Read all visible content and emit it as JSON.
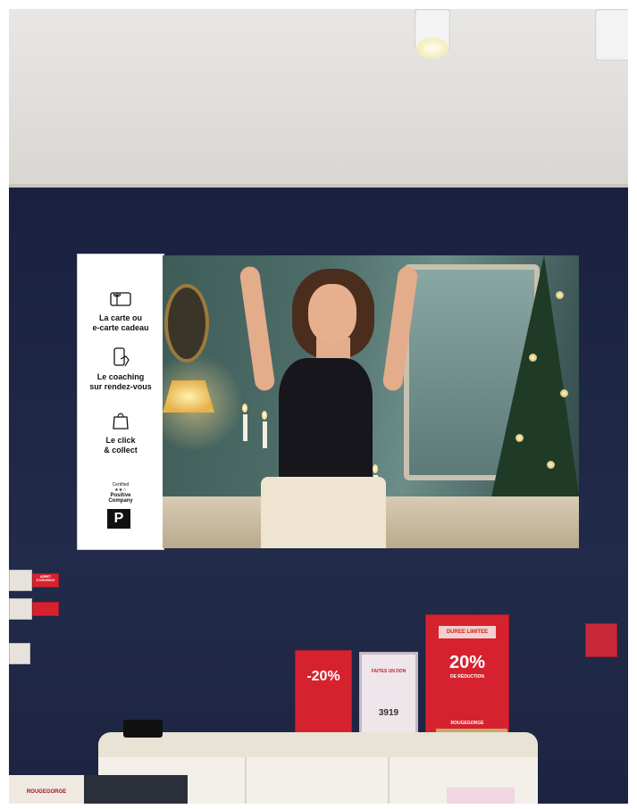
{
  "panel": {
    "services": [
      {
        "icon": "gift-card-icon",
        "label": "La carte ou\ne-carte cadeau"
      },
      {
        "icon": "phone-hand-icon",
        "label": "Le coaching\nsur rendez-vous"
      },
      {
        "icon": "shopping-bag-icon",
        "label": "Le click\n& collect"
      }
    ],
    "certified_line1": "Certified",
    "certified_line2": "Positive",
    "certified_line3": "Company",
    "logo_letter": "P"
  },
  "signs": {
    "arret_line1": "ARRET",
    "arret_line2": "D'URGENCE",
    "left_sign_pct": "-20%",
    "don_title": "FAITES UN DON",
    "don_number": "3919",
    "promo_header": "DUREE LIMITEE",
    "promo_pct": "20%",
    "promo_sub": "DE RÉDUCTION",
    "promo_brand": "ROUGEGORGE",
    "desk_brand": "ROUGEGORGE"
  },
  "colors": {
    "wall": "#1d2440",
    "sign_red": "#d6222f"
  }
}
